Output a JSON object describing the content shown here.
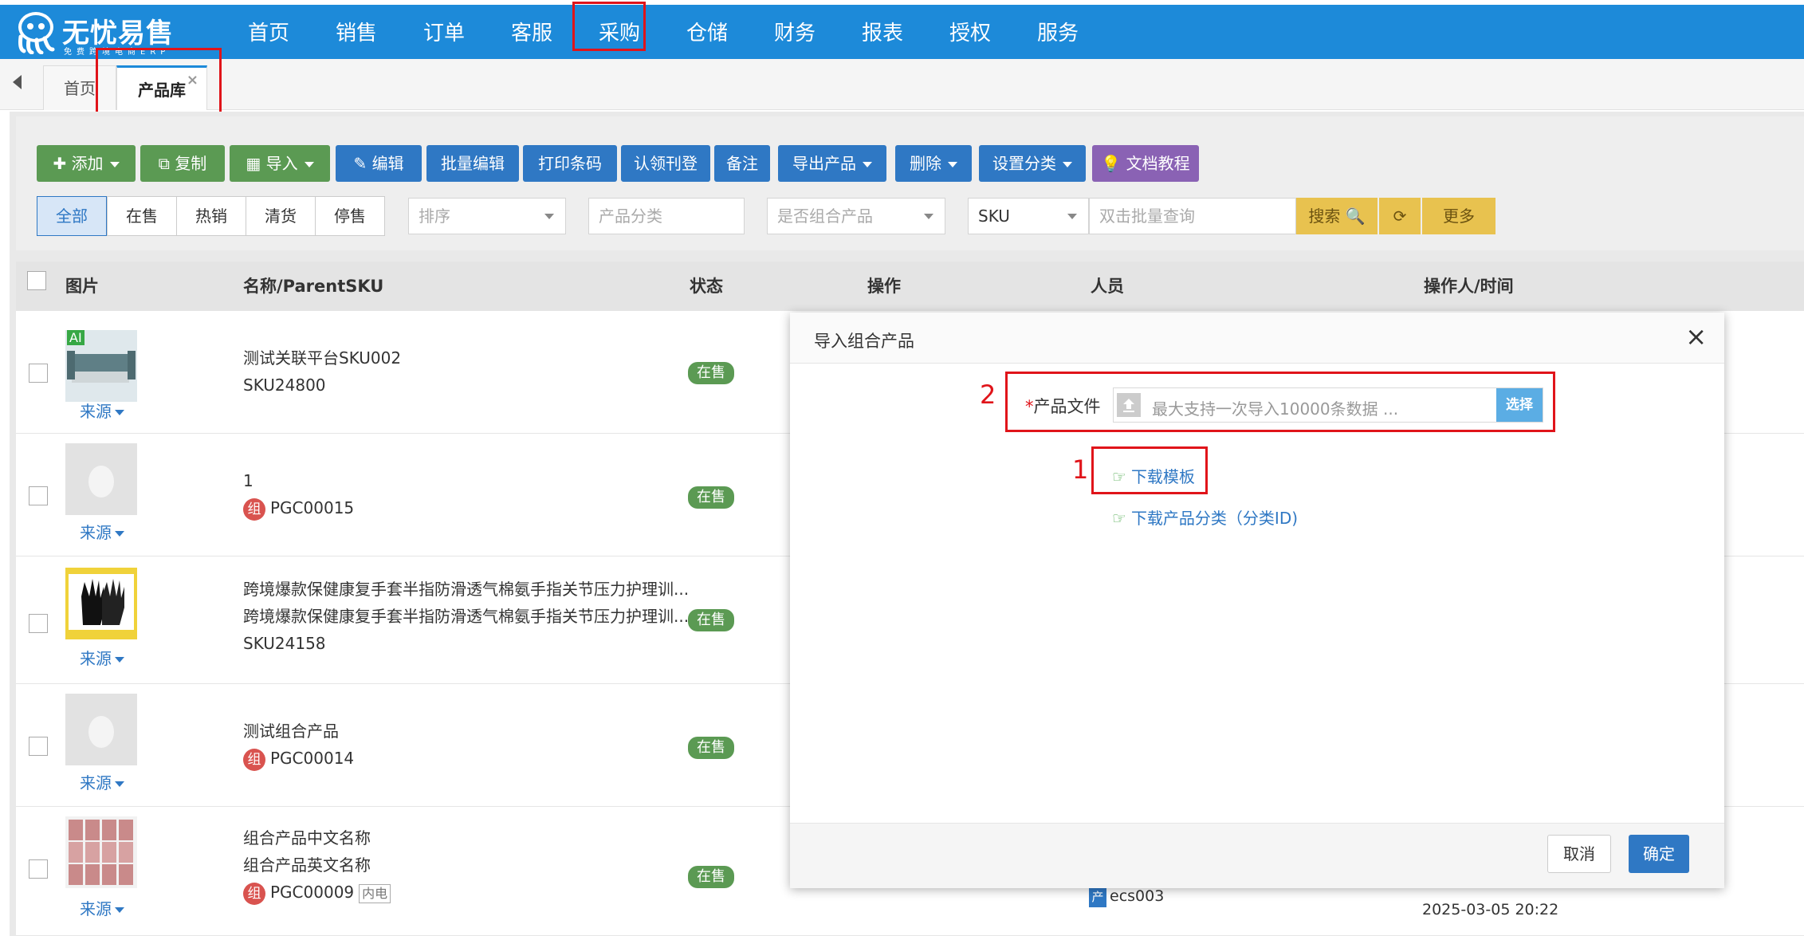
{
  "app": {
    "name": "无忧易售",
    "tagline": "免费跨境电商ERP"
  },
  "nav": [
    "首页",
    "销售",
    "订单",
    "客服",
    "采购",
    "仓储",
    "财务",
    "报表",
    "授权",
    "服务"
  ],
  "tabs": [
    {
      "label": "首页"
    },
    {
      "label": "产品库",
      "close": "×"
    }
  ],
  "toolbar": {
    "add": "添加",
    "copy": "复制",
    "import": "导入",
    "edit": "编辑",
    "batch_edit": "批量编辑",
    "print_barcode": "打印条码",
    "claim": "认领刊登",
    "note": "备注",
    "export": "导出产品",
    "delete": "删除",
    "set_category": "设置分类",
    "docs": "文档教程"
  },
  "filters": {
    "status_tabs": [
      "全部",
      "在售",
      "热销",
      "清货",
      "停售"
    ],
    "sort_placeholder": "排序",
    "category_placeholder": "产品分类",
    "combo_placeholder": "是否组合产品",
    "search_field": "SKU",
    "search_placeholder": "双击批量查询",
    "search": "搜索",
    "more": "更多"
  },
  "table": {
    "headers": [
      "图片",
      "名称/ParentSKU",
      "状态",
      "操作",
      "人员",
      "操作人/时间"
    ],
    "rows": [
      {
        "source": "来源",
        "lines": [
          "测试关联平台SKU002",
          "SKU24800"
        ],
        "status": "在售",
        "ai": "AI"
      },
      {
        "source": "来源",
        "lines": [
          "1"
        ],
        "sku": "PGC00015",
        "zu": "组",
        "status": "在售"
      },
      {
        "source": "来源",
        "lines": [
          "跨境爆款保健康复手套半指防滑透气棉氨手指关节压力护理训...",
          "跨境爆款保健康复手套半指防滑透气棉氨手指关节压力护理训...",
          "SKU24158"
        ],
        "status": "在售"
      },
      {
        "source": "来源",
        "lines": [
          "测试组合产品"
        ],
        "sku": "PGC00014",
        "zu": "组",
        "status": "在售"
      },
      {
        "source": "来源",
        "lines": [
          "组合产品中文名称",
          "组合产品英文名称"
        ],
        "sku": "PGC00009",
        "zu": "组",
        "tag": "内电",
        "status": "在售",
        "person": "ecs003",
        "person_icon": "产",
        "time": "2025-03-05 20:22"
      }
    ]
  },
  "modal": {
    "title": "导入组合产品",
    "required_mark": "*",
    "file_label": "产品文件",
    "file_placeholder": "最大支持一次导入10000条数据 ...",
    "choose": "选择",
    "download_template": "下载模板",
    "download_category": "下载产品分类（分类ID)",
    "cancel": "取消",
    "ok": "确定",
    "close": "×"
  },
  "annotations": {
    "one": "1",
    "two": "2"
  },
  "colors": {
    "nav_bg": "#1d8ad9",
    "primary": "#2f78c4",
    "success": "#5b9a53",
    "highlight": "#e0141a"
  }
}
